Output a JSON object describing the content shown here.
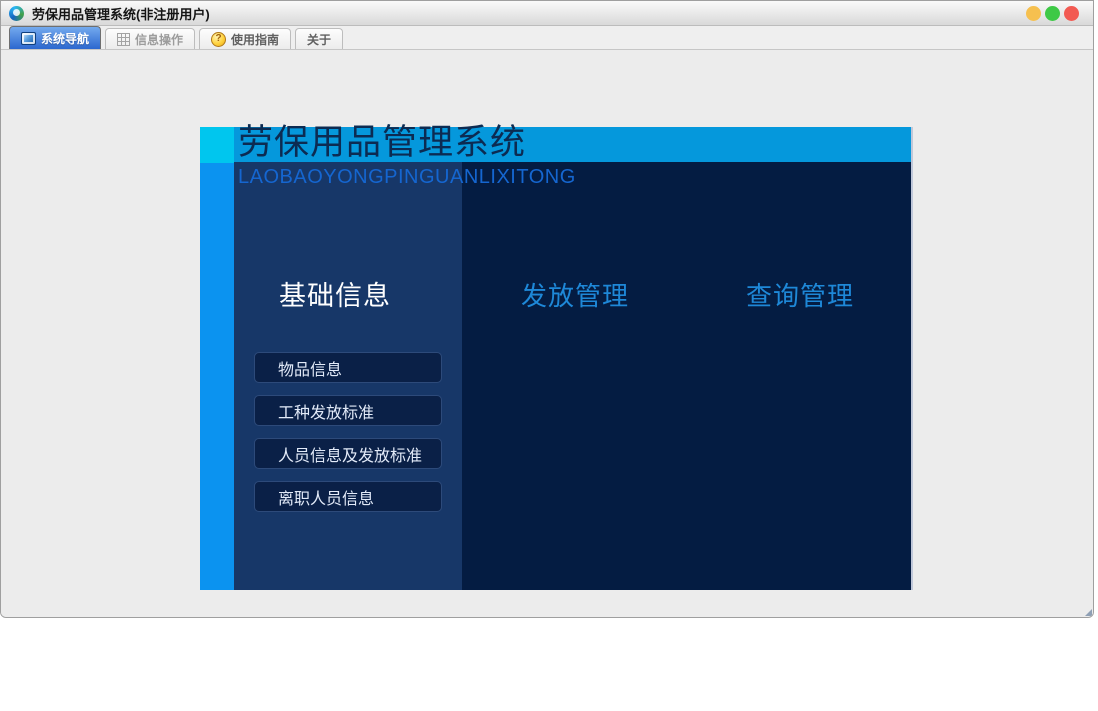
{
  "window": {
    "title": "劳保用品管理系统(非注册用户)",
    "traffic_lights": [
      {
        "name": "minimize",
        "color": "#f6c04f"
      },
      {
        "name": "zoom",
        "color": "#3ec946"
      },
      {
        "name": "close",
        "color": "#f25a52"
      }
    ]
  },
  "tabs": [
    {
      "label": "系统导航",
      "icon": "monitor-icon",
      "selected": true
    },
    {
      "label": "信息操作",
      "icon": "grid-icon",
      "selected": false
    },
    {
      "label": "使用指南",
      "icon": "help-coin-icon",
      "icon_glyph": "?",
      "selected": false
    },
    {
      "label": "关于",
      "selected": false
    }
  ],
  "panel": {
    "title": "劳保用品管理系统",
    "subtitle": "LAOBAOYONGPINGUANLIXITONG",
    "sections": [
      {
        "label": "基础信息",
        "active": true,
        "buttons": [
          "物品信息",
          "工种发放标准",
          "人员信息及发放标准",
          "离职人员信息"
        ]
      },
      {
        "label": "发放管理",
        "active": false
      },
      {
        "label": "查询管理",
        "active": false
      }
    ]
  },
  "colors": {
    "header_band": "#0598dc",
    "strip_cyan": "#00c6ee",
    "strip_blue": "#0b93f0",
    "column_active": "#173768",
    "column_dark": "#041c42",
    "section_text_blue": "#1e88d8",
    "subtitle_blue": "#1566d0",
    "selected_tab_blue": "#2b67cf"
  }
}
